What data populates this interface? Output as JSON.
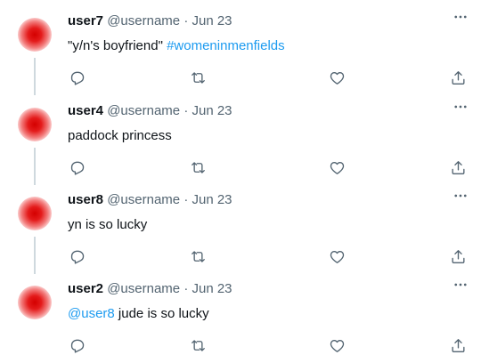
{
  "tweets": [
    {
      "name": "user7",
      "handle": "@username",
      "sep": "·",
      "date": "Jun 23",
      "text_pre": "\"y/n's boyfriend\" ",
      "text_link": "#womeninmenfields",
      "text_post": ""
    },
    {
      "name": "user4",
      "handle": "@username",
      "sep": "·",
      "date": "Jun 23",
      "text_pre": "paddock princess",
      "text_link": "",
      "text_post": ""
    },
    {
      "name": "user8",
      "handle": "@username",
      "sep": "·",
      "date": "Jun 23",
      "text_pre": "yn is so lucky",
      "text_link": "",
      "text_post": ""
    },
    {
      "name": "user2",
      "handle": "@username",
      "sep": "·",
      "date": "Jun 23",
      "text_pre": "",
      "text_link": "@user8",
      "text_post": " jude is so lucky"
    }
  ],
  "icons": {
    "more": "more-horizontal-icon",
    "reply": "reply-icon",
    "retweet": "retweet-icon",
    "like": "heart-icon",
    "share": "share-icon"
  },
  "colors": {
    "link": "#1d9bf0",
    "secondary": "#536471",
    "avatar": "#d40000"
  }
}
